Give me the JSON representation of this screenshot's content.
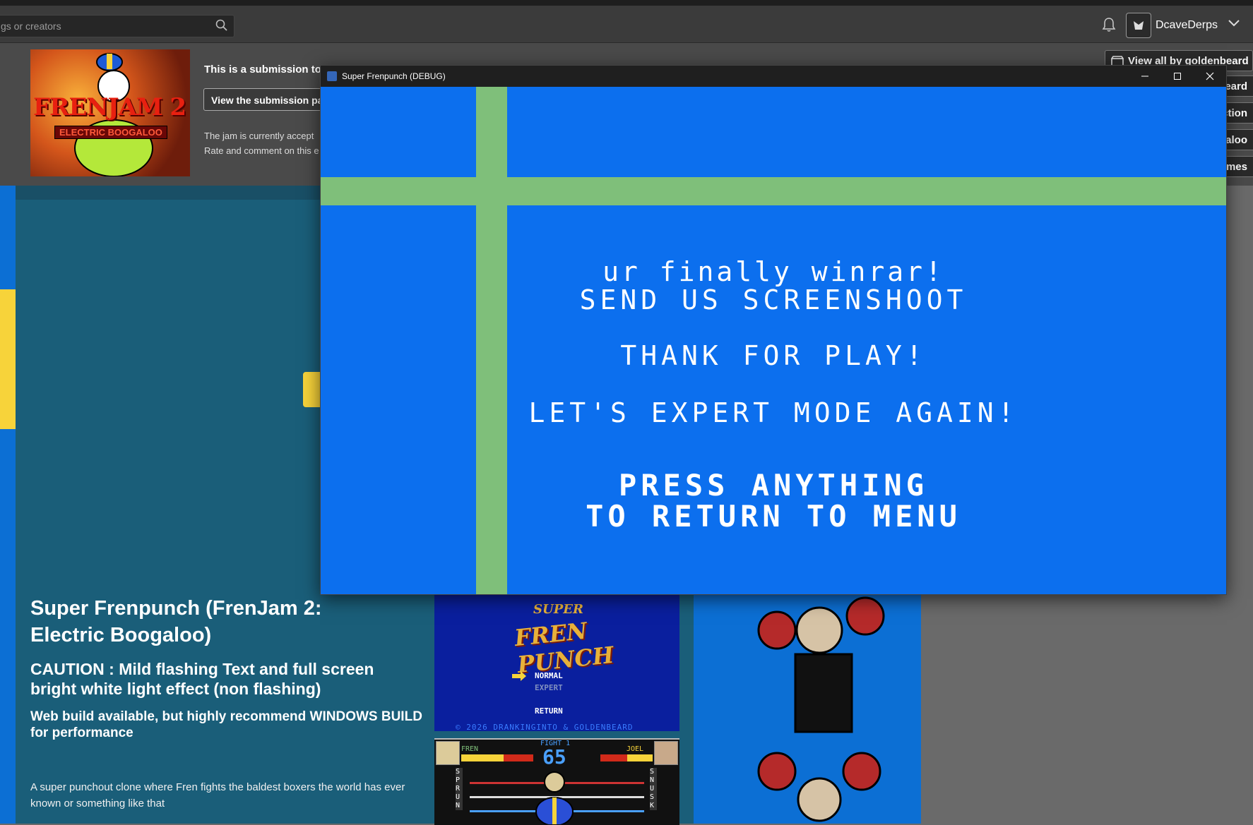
{
  "topbar": {
    "search_placeholder": "gs or creators",
    "username": "DcaveDerps"
  },
  "jam": {
    "logo_title": "FRENJAM 2",
    "logo_subtitle": "ELECTRIC BOOGALOO",
    "submission_text": "This is a submission to",
    "view_submission_label": "View the submission pag",
    "status_line1": "The jam is currently accept",
    "status_line2": "Rate and comment on this e"
  },
  "side_buttons": {
    "view_all": "View all by goldenbeard",
    "b1": "eard",
    "b2": "ction",
    "b3": "galoo",
    "b4": "ames"
  },
  "game_page": {
    "title": "Super Frenpunch (FrenJam 2: Electric Boogaloo)",
    "caution": "CAUTION : Mild flashing Text and full screen bright white light effect (non flashing)",
    "web_note": "Web build available, but highly recommend WINDOWS BUILD for performance",
    "description": "A super punchout clone where Fren fights the baldest boxers the world has ever known or something like that"
  },
  "screenshot_menu": {
    "logo_super": "SUPER",
    "logo_main": "FREN PUNCH",
    "normal": "NORMAL",
    "expert": "EXPERT",
    "return": "RETURN",
    "copyright": "© 2026 DRANKINGINTO & GOLDENBEARD"
  },
  "screenshot_fight": {
    "fight_label": "FIGHT 1",
    "timer": "65",
    "player": "FREN",
    "opponent": "JOEL",
    "left_post": "SPRUN",
    "right_post": "SNUSK"
  },
  "window": {
    "title": "Super Frenpunch (DEBUG)"
  },
  "game_screen": {
    "line1": "ur finally winrar!",
    "line2": "SEND US SCREENSHOOT",
    "line3": "THANK FOR PLAY!",
    "line4": "LET'S EXPERT MODE AGAIN!",
    "line5": "PRESS ANYTHING",
    "line6": "TO RETURN TO MENU"
  },
  "colors": {
    "game_bg": "#0c6fee",
    "cross": "#7fbf7a",
    "page_bg": "#1a5e79"
  }
}
